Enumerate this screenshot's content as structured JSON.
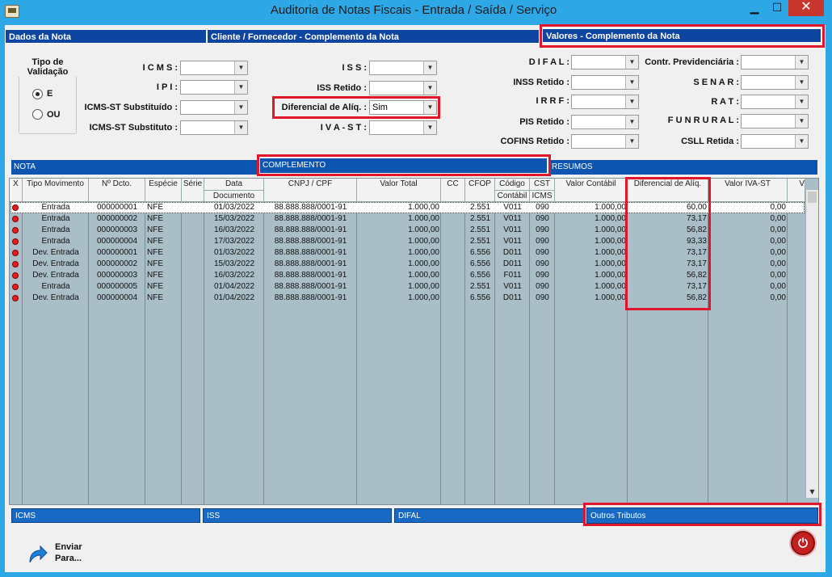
{
  "window": {
    "title": "Auditoria de Notas Fiscais   -   Entrada / Saída / Serviço",
    "min_label": "▁",
    "max_label": "☐",
    "close_label": "✕"
  },
  "sections": {
    "dados": "Dados da Nota",
    "cliente": "Cliente / Fornecedor - Complemento da Nota",
    "valores": "Valores - Complemento da Nota"
  },
  "validation": {
    "title": "Tipo de Validação",
    "option_e": "E",
    "option_ou": "OU",
    "selected": "E"
  },
  "filters": {
    "icms": {
      "label": "I C M S :",
      "value": ""
    },
    "ipi": {
      "label": "I P I :",
      "value": ""
    },
    "icms_st_substituido": {
      "label": "ICMS-ST Substituído :",
      "value": ""
    },
    "icms_st_substituto": {
      "label": "ICMS-ST Substituto :",
      "value": ""
    },
    "iss": {
      "label": "I S S :",
      "value": ""
    },
    "iss_retido": {
      "label": "ISS Retido :",
      "value": ""
    },
    "diferencial_aliq": {
      "label": "Diferencial de Alíq. :",
      "value": "Sim"
    },
    "iva_st": {
      "label": "I V A - S T :",
      "value": ""
    },
    "difal": {
      "label": "D I F A L :",
      "value": ""
    },
    "inss_retido": {
      "label": "INSS Retido :",
      "value": ""
    },
    "irrf": {
      "label": "I R R F :",
      "value": ""
    },
    "pis_retido": {
      "label": "PIS Retido :",
      "value": ""
    },
    "cofins_retido": {
      "label": "COFINS Retido :",
      "value": ""
    },
    "contr_previdenciaria": {
      "label": "Contr. Previdenciária :",
      "value": ""
    },
    "senar": {
      "label": "S E N A R :",
      "value": ""
    },
    "rat": {
      "label": "R A T :",
      "value": ""
    },
    "funrural": {
      "label": "F U N R U R A L :",
      "value": ""
    },
    "csll_retida": {
      "label": "CSLL Retida :",
      "value": ""
    }
  },
  "tabs": {
    "nota": "NOTA",
    "complemento": "COMPLEMENTO",
    "resumos": "RESUMOS"
  },
  "grid": {
    "headers": {
      "x": "X",
      "tipo": "Tipo Movimento",
      "ndcto": "Nº Dcto.",
      "especie": "Espécie",
      "serie": "Série",
      "data": "Data",
      "data_sub": "Documento",
      "cnpj": "CNPJ / CPF",
      "valor_total": "Valor Total",
      "cc": "CC",
      "cfop": "CFOP",
      "codigo": "Código",
      "codigo_sub": "Contábil",
      "cst": "CST",
      "cst_sub": "ICMS",
      "valor_contabil": "Valor Contábil",
      "dif_aliq": "Diferencial de Alíq.",
      "valor_iva_st": "Valor IVA-ST",
      "extra": "V"
    },
    "rows": [
      {
        "tipo": "Entrada",
        "ndcto": "000000001",
        "especie": "NFE",
        "serie": "",
        "data": "01/03/2022",
        "cnpj": "88.888.888/0001-91",
        "valor_total": "1.000,00",
        "cc": "",
        "cfop": "2.551",
        "codigo": "V011",
        "cst": "090",
        "valor_contabil": "1.000,00",
        "dif_aliq": "60,00",
        "valor_iva_st": "0,00"
      },
      {
        "tipo": "Entrada",
        "ndcto": "000000002",
        "especie": "NFE",
        "serie": "",
        "data": "15/03/2022",
        "cnpj": "88.888.888/0001-91",
        "valor_total": "1.000,00",
        "cc": "",
        "cfop": "2.551",
        "codigo": "V011",
        "cst": "090",
        "valor_contabil": "1.000,00",
        "dif_aliq": "73,17",
        "valor_iva_st": "0,00"
      },
      {
        "tipo": "Entrada",
        "ndcto": "000000003",
        "especie": "NFE",
        "serie": "",
        "data": "16/03/2022",
        "cnpj": "88.888.888/0001-91",
        "valor_total": "1.000,00",
        "cc": "",
        "cfop": "2.551",
        "codigo": "V011",
        "cst": "090",
        "valor_contabil": "1.000,00",
        "dif_aliq": "56,82",
        "valor_iva_st": "0,00"
      },
      {
        "tipo": "Entrada",
        "ndcto": "000000004",
        "especie": "NFE",
        "serie": "",
        "data": "17/03/2022",
        "cnpj": "88.888.888/0001-91",
        "valor_total": "1.000,00",
        "cc": "",
        "cfop": "2.551",
        "codigo": "V011",
        "cst": "090",
        "valor_contabil": "1.000,00",
        "dif_aliq": "93,33",
        "valor_iva_st": "0,00"
      },
      {
        "tipo": "Dev. Entrada",
        "ndcto": "000000001",
        "especie": "NFE",
        "serie": "",
        "data": "01/03/2022",
        "cnpj": "88.888.888/0001-91",
        "valor_total": "1.000,00",
        "cc": "",
        "cfop": "6.556",
        "codigo": "D011",
        "cst": "090",
        "valor_contabil": "1.000,00",
        "dif_aliq": "73,17",
        "valor_iva_st": "0,00"
      },
      {
        "tipo": "Dev. Entrada",
        "ndcto": "000000002",
        "especie": "NFE",
        "serie": "",
        "data": "15/03/2022",
        "cnpj": "88.888.888/0001-91",
        "valor_total": "1.000,00",
        "cc": "",
        "cfop": "6.556",
        "codigo": "D011",
        "cst": "090",
        "valor_contabil": "1.000,00",
        "dif_aliq": "73,17",
        "valor_iva_st": "0,00"
      },
      {
        "tipo": "Dev. Entrada",
        "ndcto": "000000003",
        "especie": "NFE",
        "serie": "",
        "data": "16/03/2022",
        "cnpj": "88.888.888/0001-91",
        "valor_total": "1.000,00",
        "cc": "",
        "cfop": "6.556",
        "codigo": "F011",
        "cst": "090",
        "valor_contabil": "1.000,00",
        "dif_aliq": "56,82",
        "valor_iva_st": "0,00"
      },
      {
        "tipo": "Entrada",
        "ndcto": "000000005",
        "especie": "NFE",
        "serie": "",
        "data": "01/04/2022",
        "cnpj": "88.888.888/0001-91",
        "valor_total": "1.000,00",
        "cc": "",
        "cfop": "2.551",
        "codigo": "V011",
        "cst": "090",
        "valor_contabil": "1.000,00",
        "dif_aliq": "73,17",
        "valor_iva_st": "0,00"
      },
      {
        "tipo": "Dev. Entrada",
        "ndcto": "000000004",
        "especie": "NFE",
        "serie": "",
        "data": "01/04/2022",
        "cnpj": "88.888.888/0001-91",
        "valor_total": "1.000,00",
        "cc": "",
        "cfop": "6.556",
        "codigo": "D011",
        "cst": "090",
        "valor_contabil": "1.000,00",
        "dif_aliq": "56,82",
        "valor_iva_st": "0,00"
      }
    ]
  },
  "bottom_tabs": {
    "icms": "ICMS",
    "iss": "ISS",
    "difal": "DIFAL",
    "outros": "Outros Tributos"
  },
  "actions": {
    "send_line1": "Enviar",
    "send_line2": "Para..."
  },
  "colors": {
    "header_blue": "#0d45a1",
    "highlight_red": "#e0162b",
    "grid_bg": "#a9bec7"
  }
}
